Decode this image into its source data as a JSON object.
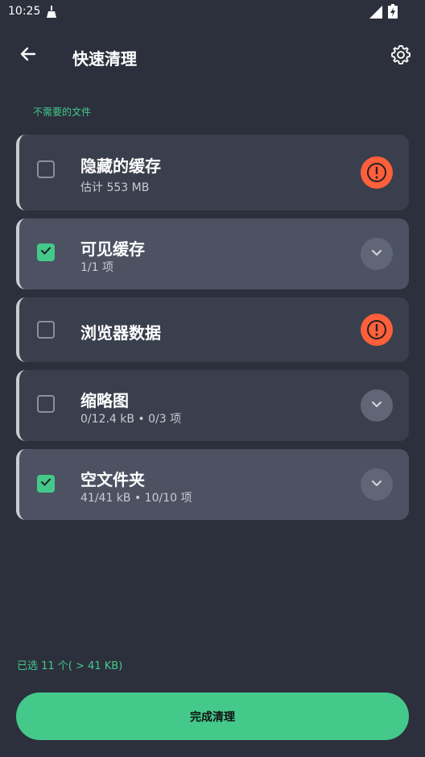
{
  "status_bar": {
    "time": "10:25",
    "app_icon": "broom-icon",
    "signal_icon": "signal-icon",
    "battery_icon": "battery-charging-icon"
  },
  "header": {
    "title": "快速清理",
    "back_icon": "arrow-back-icon",
    "settings_icon": "gear-icon"
  },
  "section": {
    "label": "不需要的文件"
  },
  "items": [
    {
      "title": "隐藏的缓存",
      "subtitle": "估计 553 MB",
      "checked": false,
      "action_icon": "warning-icon"
    },
    {
      "title": "可见缓存",
      "subtitle": "1/1 项",
      "checked": true,
      "action_icon": "chevron-down-icon"
    },
    {
      "title": "浏览器数据",
      "subtitle": "",
      "checked": false,
      "action_icon": "warning-icon"
    },
    {
      "title": "缩略图",
      "subtitle": "0/12.4 kB • 0/3 项",
      "checked": false,
      "action_icon": "chevron-down-icon"
    },
    {
      "title": "空文件夹",
      "subtitle": "41/41 kB • 10/10 项",
      "checked": true,
      "action_icon": "chevron-down-icon"
    }
  ],
  "footer": {
    "summary": "已选 11 个( > 41 KB)",
    "button_label": "完成清理"
  },
  "colors": {
    "background": "#2c303d",
    "card": "#3a3f4d",
    "card_selected": "#4c5262",
    "accent": "#44c98a",
    "warning": "#ff5f3b"
  }
}
